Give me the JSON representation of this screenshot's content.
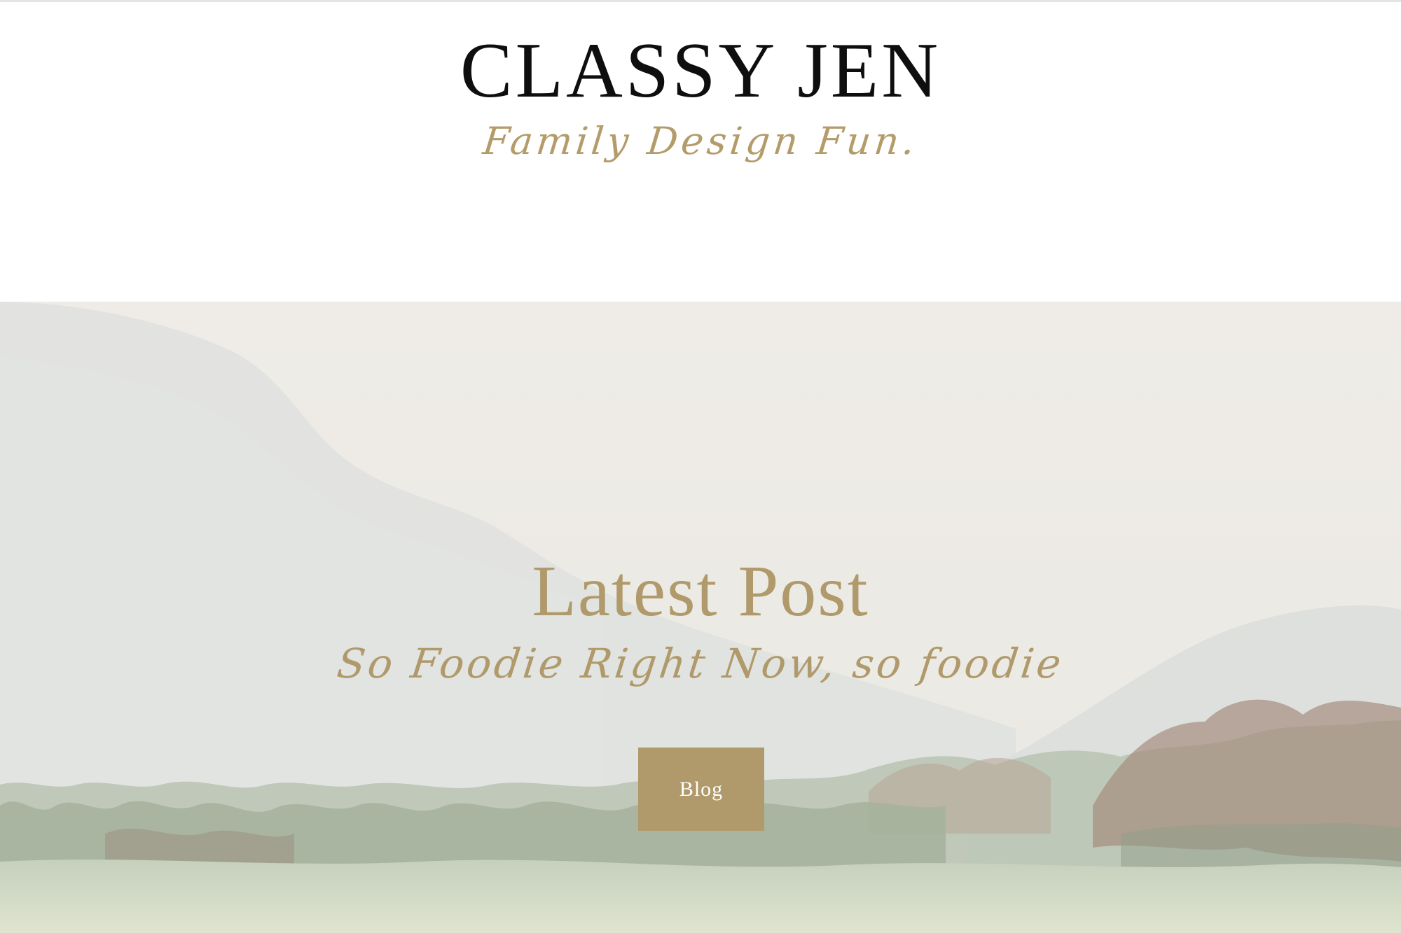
{
  "header": {
    "site_title": "CLASSY JEN",
    "tagline": "Family Design Fun."
  },
  "hero": {
    "heading": "Latest Post",
    "subheading": "So Foodie Right Now, so foodie",
    "button_label": "Blog"
  },
  "colors": {
    "accent_gold": "#b09a6b",
    "title_black": "#0e0e0e",
    "paper_bg": "#ece9e3",
    "foliage_green": "#9fae94",
    "foliage_brown": "#a48c7c"
  }
}
